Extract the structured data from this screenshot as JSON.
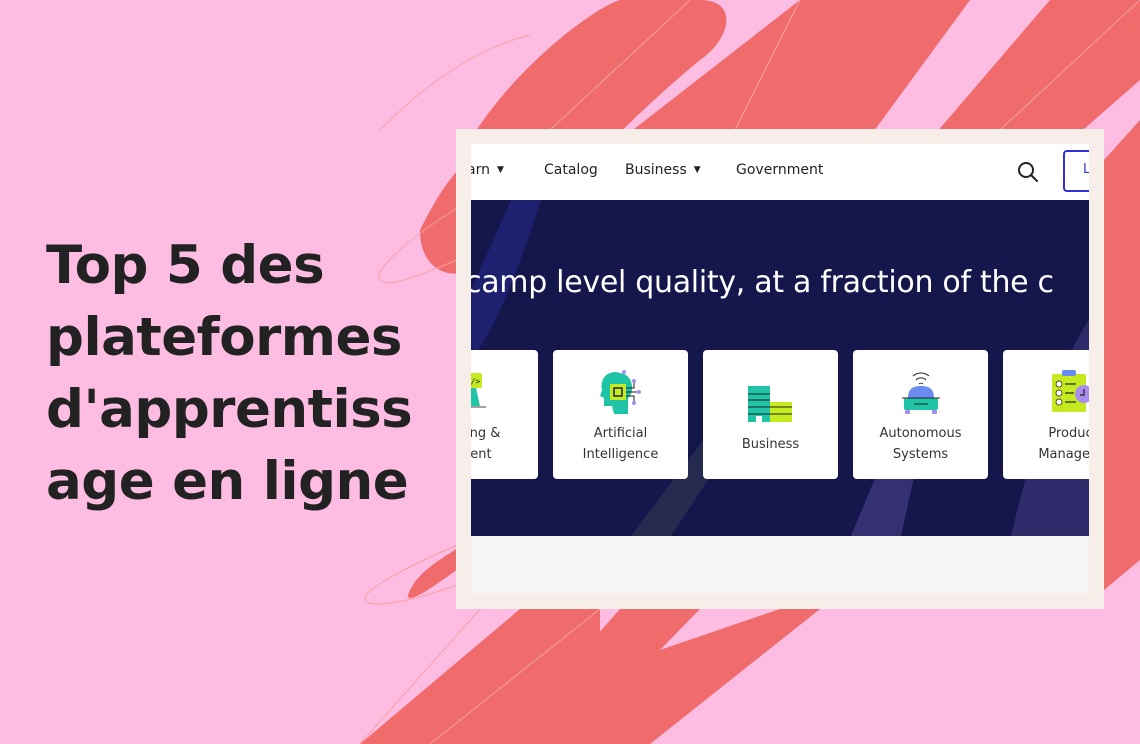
{
  "headline": {
    "lines": [
      "Top 5 des",
      "plateformes",
      "d'apprentiss",
      "age en ligne"
    ]
  },
  "colors": {
    "background": "#fdbde3",
    "stroke": "#f06b6b",
    "frame": "#f8eee9",
    "hero": "#15174c",
    "accent": "#3030d8"
  },
  "screenshot": {
    "nav": {
      "items": [
        {
          "label": "arn",
          "has_caret": true
        },
        {
          "label": "Catalog",
          "has_caret": false
        },
        {
          "label": "Business",
          "has_caret": true
        },
        {
          "label": "Government",
          "has_caret": false
        }
      ],
      "caret": "▼",
      "search_icon": "search-icon",
      "login_label": "L"
    },
    "hero": {
      "headline": "camp level quality, at a fraction of the c"
    },
    "categories": [
      {
        "label_lines": [
          "mming &",
          "pment"
        ],
        "icon": "code-laptop-icon"
      },
      {
        "label_lines": [
          "Artificial",
          "Intelligence"
        ],
        "icon": "ai-head-icon"
      },
      {
        "label_lines": [
          "Business"
        ],
        "icon": "buildings-icon"
      },
      {
        "label_lines": [
          "Autonomous",
          "Systems"
        ],
        "icon": "autonomous-car-icon"
      },
      {
        "label_lines": [
          "Produc",
          "Managem"
        ],
        "icon": "checklist-clock-icon"
      }
    ]
  }
}
